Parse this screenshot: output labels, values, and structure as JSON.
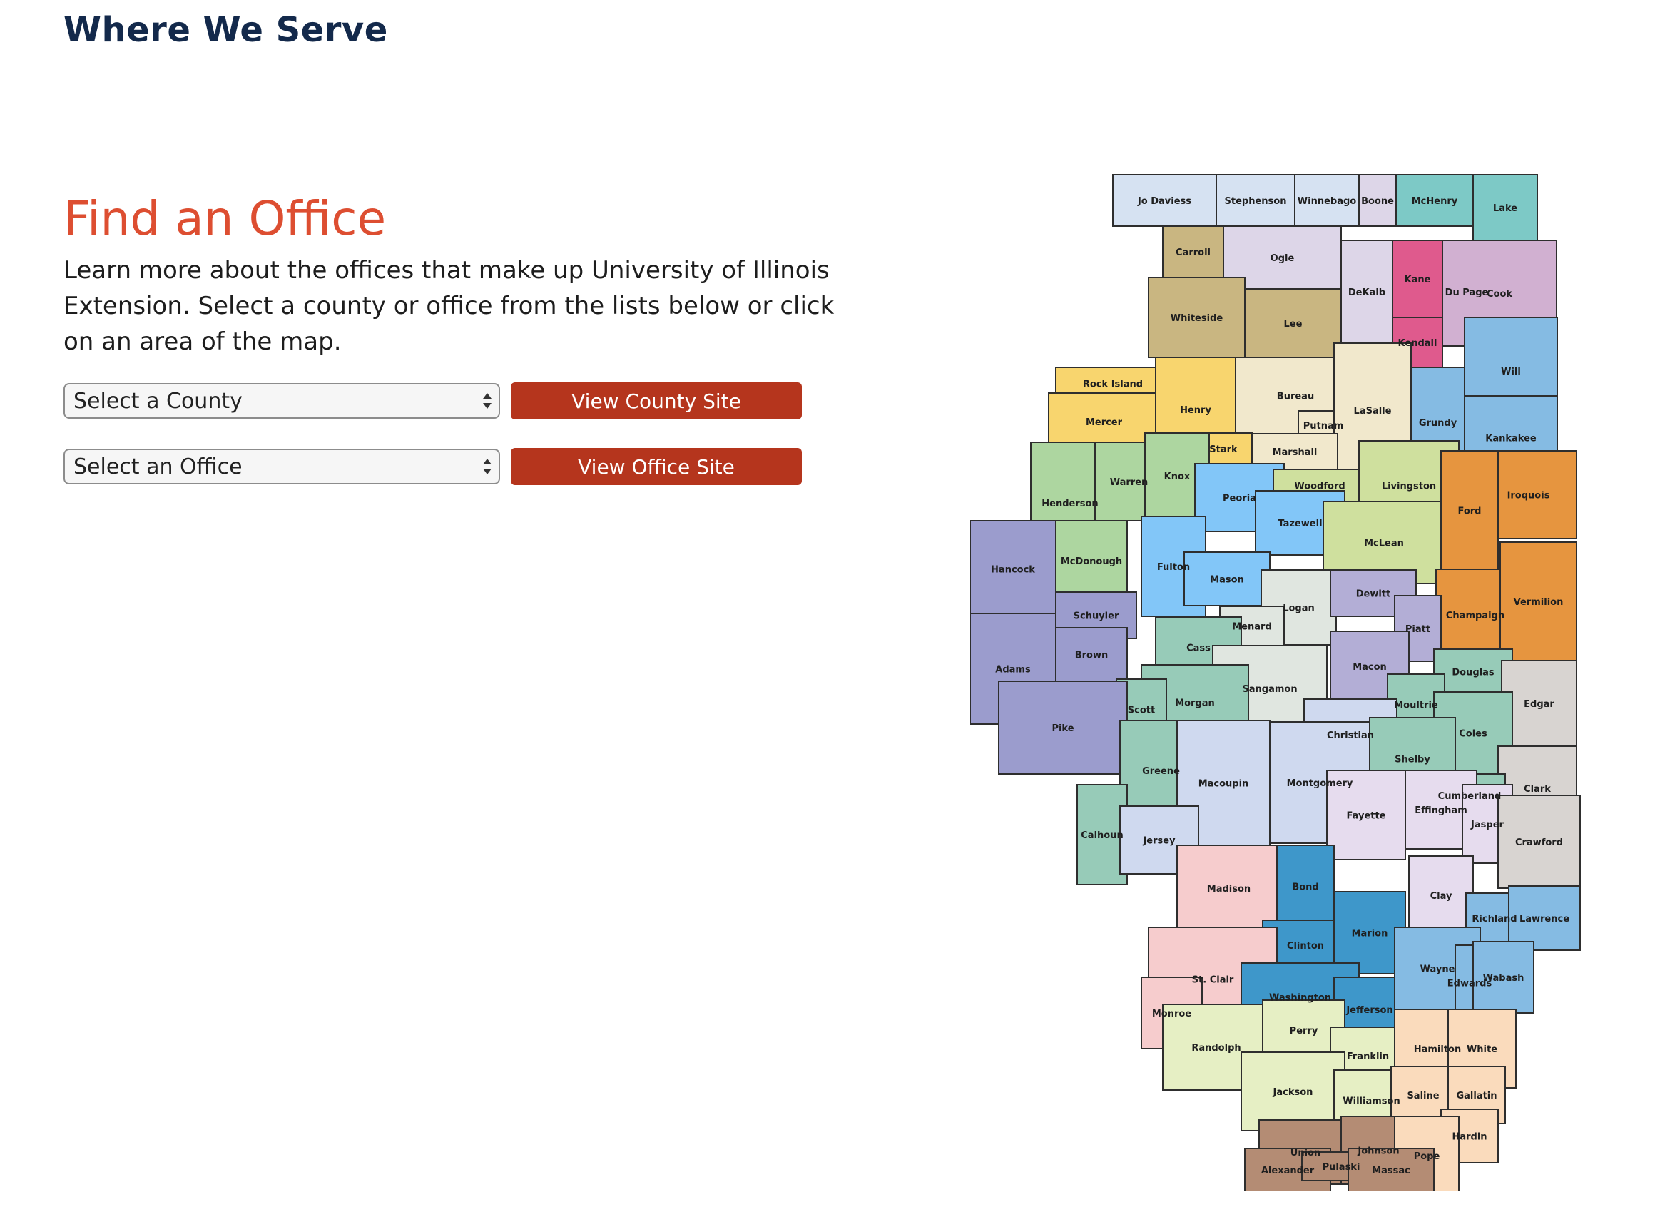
{
  "header": {
    "title": "Where We Serve"
  },
  "find_office": {
    "title": "Find an Office",
    "intro": "Learn more about the offices that make up University of Illinois Extension. Select a county or office from the lists below or click on an area of the map."
  },
  "county_select": {
    "selected": "Select a County",
    "button_label": "View County Site"
  },
  "office_select": {
    "selected": "Select an Office",
    "button_label": "View Office Site"
  },
  "colors": {
    "heading": "#13294b",
    "accent": "#dd4e31",
    "button": "#b5351d"
  },
  "map": {
    "counties": [
      {
        "name": "Jo Daviess",
        "color": "#d6e2f2"
      },
      {
        "name": "Stephenson",
        "color": "#d6e2f2"
      },
      {
        "name": "Winnebago",
        "color": "#d6e2f2"
      },
      {
        "name": "Boone",
        "color": "#ddd6e8"
      },
      {
        "name": "McHenry",
        "color": "#7dc9c6"
      },
      {
        "name": "Lake",
        "color": "#7dc9c6"
      },
      {
        "name": "Carroll",
        "color": "#c9b681"
      },
      {
        "name": "Ogle",
        "color": "#ddd6e8"
      },
      {
        "name": "DeKalb",
        "color": "#ddd6e8"
      },
      {
        "name": "Kane",
        "color": "#df5a8d"
      },
      {
        "name": "Du Page",
        "color": "#df5a8d"
      },
      {
        "name": "Cook",
        "color": "#d1b0d1"
      },
      {
        "name": "Whiteside",
        "color": "#c9b681"
      },
      {
        "name": "Lee",
        "color": "#c9b681"
      },
      {
        "name": "Kendall",
        "color": "#df5a8d"
      },
      {
        "name": "Rock Island",
        "color": "#f8d56e"
      },
      {
        "name": "Mercer",
        "color": "#f8d56e"
      },
      {
        "name": "Henry",
        "color": "#f8d56e"
      },
      {
        "name": "Bureau",
        "color": "#f1e8cc"
      },
      {
        "name": "Putnam",
        "color": "#f1e8cc"
      },
      {
        "name": "LaSalle",
        "color": "#f1e8cc"
      },
      {
        "name": "Grundy",
        "color": "#85bbe3"
      },
      {
        "name": "Will",
        "color": "#85bbe3"
      },
      {
        "name": "Kankakee",
        "color": "#85bbe3"
      },
      {
        "name": "Stark",
        "color": "#f8d56e"
      },
      {
        "name": "Marshall",
        "color": "#f1e8cc"
      },
      {
        "name": "Henderson",
        "color": "#add6a0"
      },
      {
        "name": "Warren",
        "color": "#add6a0"
      },
      {
        "name": "Knox",
        "color": "#add6a0"
      },
      {
        "name": "Peoria",
        "color": "#82c6f8"
      },
      {
        "name": "Woodford",
        "color": "#cfe09e"
      },
      {
        "name": "Livingston",
        "color": "#cfe09e"
      },
      {
        "name": "Iroquois",
        "color": "#e6953f"
      },
      {
        "name": "Tazewell",
        "color": "#82c6f8"
      },
      {
        "name": "McLean",
        "color": "#cfe09e"
      },
      {
        "name": "Ford",
        "color": "#e6953f"
      },
      {
        "name": "Hancock",
        "color": "#9b9ccd"
      },
      {
        "name": "McDonough",
        "color": "#add6a0"
      },
      {
        "name": "Fulton",
        "color": "#82c6f8"
      },
      {
        "name": "Mason",
        "color": "#82c6f8"
      },
      {
        "name": "Logan",
        "color": "#e0e6e0"
      },
      {
        "name": "Dewitt",
        "color": "#b3aed6"
      },
      {
        "name": "Champaign",
        "color": "#e6953f"
      },
      {
        "name": "Vermilion",
        "color": "#e6953f"
      },
      {
        "name": "Schuyler",
        "color": "#9b9ccd"
      },
      {
        "name": "Menard",
        "color": "#e0e6e0"
      },
      {
        "name": "Piatt",
        "color": "#b3aed6"
      },
      {
        "name": "Adams",
        "color": "#9b9ccd"
      },
      {
        "name": "Brown",
        "color": "#9b9ccd"
      },
      {
        "name": "Cass",
        "color": "#97cbb8"
      },
      {
        "name": "Sangamon",
        "color": "#e0e6e0"
      },
      {
        "name": "Macon",
        "color": "#b3aed6"
      },
      {
        "name": "Douglas",
        "color": "#97cbb8"
      },
      {
        "name": "Edgar",
        "color": "#d8d4d1"
      },
      {
        "name": "Morgan",
        "color": "#97cbb8"
      },
      {
        "name": "Scott",
        "color": "#97cbb8"
      },
      {
        "name": "Moultrie",
        "color": "#97cbb8"
      },
      {
        "name": "Pike",
        "color": "#9b9ccd"
      },
      {
        "name": "Christian",
        "color": "#cfd9ef"
      },
      {
        "name": "Coles",
        "color": "#97cbb8"
      },
      {
        "name": "Shelby",
        "color": "#97cbb8"
      },
      {
        "name": "Clark",
        "color": "#d8d4d1"
      },
      {
        "name": "Greene",
        "color": "#97cbb8"
      },
      {
        "name": "Macoupin",
        "color": "#cfd9ef"
      },
      {
        "name": "Montgomery",
        "color": "#cfd9ef"
      },
      {
        "name": "Cumberland",
        "color": "#97cbb8"
      },
      {
        "name": "Calhoun",
        "color": "#97cbb8"
      },
      {
        "name": "Jersey",
        "color": "#cfd9ef"
      },
      {
        "name": "Fayette",
        "color": "#e6dcee"
      },
      {
        "name": "Effingham",
        "color": "#e6dcee"
      },
      {
        "name": "Jasper",
        "color": "#e6dcee"
      },
      {
        "name": "Crawford",
        "color": "#d8d4d1"
      },
      {
        "name": "Madison",
        "color": "#f6cccd"
      },
      {
        "name": "Bond",
        "color": "#3e97ca"
      },
      {
        "name": "Clay",
        "color": "#e6dcee"
      },
      {
        "name": "Richland",
        "color": "#85bbe3"
      },
      {
        "name": "Lawrence",
        "color": "#85bbe3"
      },
      {
        "name": "Clinton",
        "color": "#3e97ca"
      },
      {
        "name": "Marion",
        "color": "#3e97ca"
      },
      {
        "name": "St. Clair",
        "color": "#f6cccd"
      },
      {
        "name": "Washington",
        "color": "#3e97ca"
      },
      {
        "name": "Jefferson",
        "color": "#3e97ca"
      },
      {
        "name": "Wayne",
        "color": "#85bbe3"
      },
      {
        "name": "Edwards",
        "color": "#85bbe3"
      },
      {
        "name": "Wabash",
        "color": "#85bbe3"
      },
      {
        "name": "Monroe",
        "color": "#f6cccd"
      },
      {
        "name": "Randolph",
        "color": "#e6efc4"
      },
      {
        "name": "Perry",
        "color": "#e6efc4"
      },
      {
        "name": "Franklin",
        "color": "#e6efc4"
      },
      {
        "name": "Hamilton",
        "color": "#fadbbc"
      },
      {
        "name": "White",
        "color": "#fadbbc"
      },
      {
        "name": "Jackson",
        "color": "#e6efc4"
      },
      {
        "name": "Williamson",
        "color": "#e6efc4"
      },
      {
        "name": "Saline",
        "color": "#fadbbc"
      },
      {
        "name": "Gallatin",
        "color": "#fadbbc"
      },
      {
        "name": "Hardin",
        "color": "#fadbbc"
      },
      {
        "name": "Union",
        "color": "#b48c74"
      },
      {
        "name": "Johnson",
        "color": "#b48c74"
      },
      {
        "name": "Pope",
        "color": "#fadbbc"
      },
      {
        "name": "Alexander",
        "color": "#b48c74"
      },
      {
        "name": "Pulaski",
        "color": "#b48c74"
      },
      {
        "name": "Massac",
        "color": "#b48c74"
      }
    ]
  }
}
